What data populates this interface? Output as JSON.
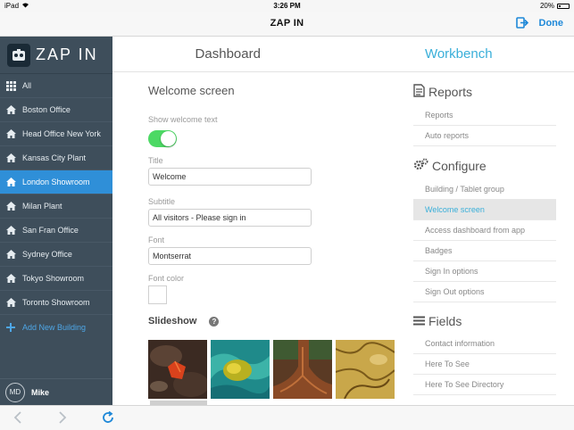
{
  "status_bar": {
    "device": "iPad",
    "time": "3:26 PM",
    "battery": "20%"
  },
  "nav": {
    "title": "ZAP IN",
    "done_label": "Done"
  },
  "sidebar": {
    "brand": "ZAP IN",
    "items": [
      {
        "label": "All",
        "icon": "grid-icon"
      },
      {
        "label": "Boston Office",
        "icon": "home-icon"
      },
      {
        "label": "Head Office New York",
        "icon": "home-icon"
      },
      {
        "label": "Kansas City Plant",
        "icon": "home-icon"
      },
      {
        "label": "London Showroom",
        "icon": "home-icon",
        "active": true
      },
      {
        "label": "Milan Plant",
        "icon": "home-icon"
      },
      {
        "label": "San Fran Office",
        "icon": "home-icon"
      },
      {
        "label": "Sydney Office",
        "icon": "home-icon"
      },
      {
        "label": "Tokyo Showroom",
        "icon": "home-icon"
      },
      {
        "label": "Toronto Showroom",
        "icon": "home-icon"
      }
    ],
    "add_label": "Add New Building",
    "user": {
      "initials": "MD",
      "name": "Mike"
    }
  },
  "tabs": [
    {
      "label": "Dashboard",
      "active": false
    },
    {
      "label": "Workbench",
      "active": true
    }
  ],
  "welcome": {
    "section_title": "Welcome screen",
    "show_text_label": "Show welcome text",
    "show_text_enabled": true,
    "title_label": "Title",
    "title_value": "Welcome",
    "subtitle_label": "Subtitle",
    "subtitle_value": "All visitors - Please sign in",
    "font_label": "Font",
    "font_value": "Montserrat",
    "font_color_label": "Font color",
    "font_color_value": "#ffffff",
    "slideshow_label": "Slideshow",
    "help_glyph": "?"
  },
  "right_panel": {
    "reports": {
      "heading": "Reports",
      "items": [
        "Reports",
        "Auto reports"
      ]
    },
    "configure": {
      "heading": "Configure",
      "items": [
        "Building / Tablet group",
        "Welcome screen",
        "Access dashboard from app",
        "Badges",
        "Sign In options",
        "Sign Out options"
      ],
      "selected": "Welcome screen"
    },
    "fields": {
      "heading": "Fields",
      "items": [
        "Contact information",
        "Here To See",
        "Here To See Directory"
      ]
    }
  },
  "colors": {
    "accent": "#3aafd9",
    "sidebar_bg": "#3e4e5b",
    "active_item": "#2f8fd8",
    "toggle_on": "#4cd964",
    "done_blue": "#1e88d8"
  }
}
